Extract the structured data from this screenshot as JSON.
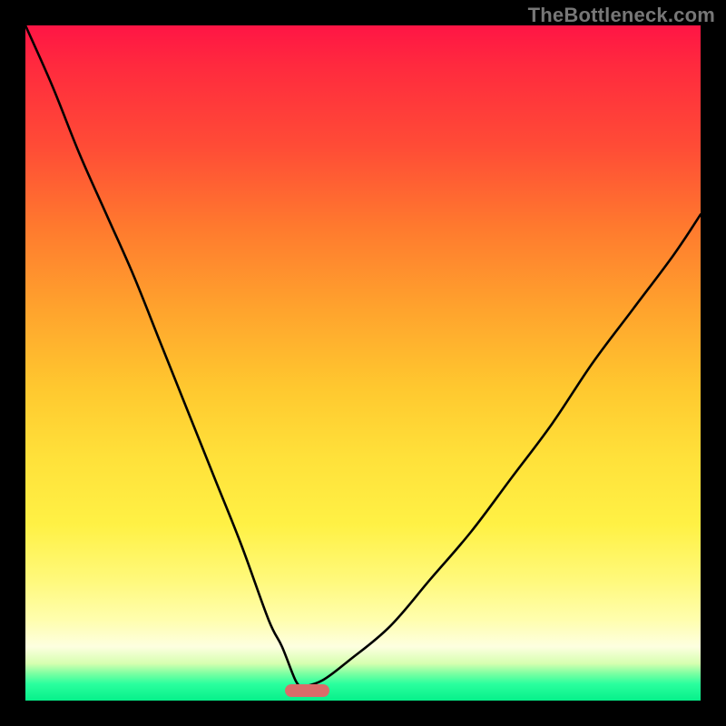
{
  "watermark": "TheBottleneck.com",
  "chart_data": {
    "type": "line",
    "title": "",
    "xlabel": "",
    "ylabel": "",
    "xlim": [
      0,
      100
    ],
    "ylim": [
      0,
      100
    ],
    "grid": false,
    "legend": false,
    "description": "Two monotone curves descending from top edges to a common minimum near x≈41, y≈2, overlaid on a vertical red→yellow→green gradient. A small horizontal pink bar marks the minimum region.",
    "series": [
      {
        "name": "left-curve",
        "x": [
          0,
          4,
          8,
          12,
          16,
          20,
          24,
          28,
          32,
          36,
          38,
          40,
          41
        ],
        "y": [
          100,
          91,
          81,
          72,
          63,
          53,
          43,
          33,
          23,
          12,
          8,
          3,
          2
        ]
      },
      {
        "name": "right-curve",
        "x": [
          41,
          44,
          48,
          54,
          60,
          66,
          72,
          78,
          84,
          90,
          96,
          100
        ],
        "y": [
          2,
          3,
          6,
          11,
          18,
          25,
          33,
          41,
          50,
          58,
          66,
          72
        ]
      }
    ],
    "marker": {
      "name": "min-bar",
      "x_start": 38.5,
      "x_end": 45,
      "y": 1.5,
      "color": "#da6c6a"
    },
    "gradient_stops": [
      {
        "pos": 0,
        "color": "#ff1545"
      },
      {
        "pos": 0.5,
        "color": "#ffc92f"
      },
      {
        "pos": 0.92,
        "color": "#fdffe0"
      },
      {
        "pos": 1.0,
        "color": "#06f08a"
      }
    ]
  }
}
